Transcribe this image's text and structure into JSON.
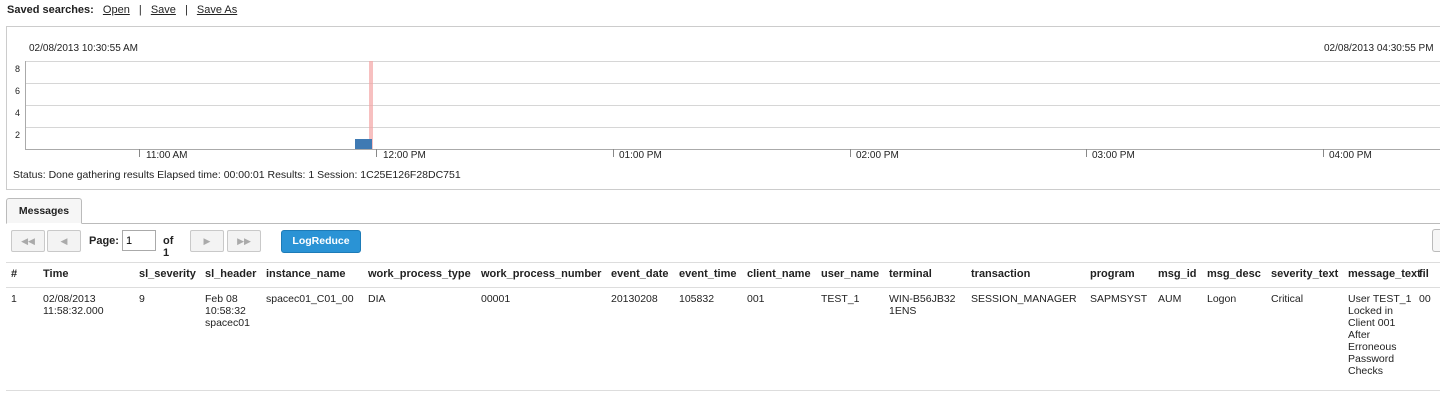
{
  "saved": {
    "label": "Saved searches:",
    "open": "Open",
    "save": "Save",
    "save_as": "Save As",
    "sep": "|"
  },
  "timeline": {
    "start_date": "02/08/2013 10:30:55 AM",
    "end_date": "02/08/2013 04:30:55 PM",
    "y_ticks": [
      "8",
      "6",
      "4",
      "2"
    ],
    "x_ticks": [
      "11:00 AM",
      "12:00 PM",
      "01:00 PM",
      "02:00 PM",
      "03:00 PM",
      "04:00 PM"
    ],
    "status": "Status: Done gathering results  Elapsed time: 00:00:01  Results: 1  Session: 1C25E126F28DC751",
    "colors": {
      "bar": "#3f7ab3",
      "marker": "#f3a5a5"
    }
  },
  "chart_data": {
    "type": "bar",
    "x_range": [
      "02/08/2013 10:30:55 AM",
      "02/08/2013 04:30:55 PM"
    ],
    "ylim": [
      0,
      9
    ],
    "points": [
      {
        "time": "02/08/2013 11:58:32 AM",
        "value": 1
      }
    ]
  },
  "tabs": [
    {
      "label": "Messages"
    }
  ],
  "pager": {
    "page_label": "Page:",
    "page_value": "1",
    "of_label": "of 1",
    "logreduce": "LogReduce"
  },
  "table": {
    "columns": [
      "#",
      "Time",
      "sl_severity",
      "sl_header",
      "instance_name",
      "work_process_type",
      "work_process_number",
      "event_date",
      "event_time",
      "client_name",
      "user_name",
      "terminal",
      "transaction",
      "program",
      "msg_id",
      "msg_desc",
      "severity_text",
      "message_text",
      "fil"
    ],
    "rows": [
      [
        "1",
        "02/08/2013 11:58:32.000",
        "9",
        "Feb 08 10:58:32 spacec01",
        "spacec01_C01_00",
        "DIA",
        "00001",
        "20130208",
        "105832",
        "001",
        "TEST_1",
        "WIN-B56JB321ENS",
        "SESSION_MANAGER",
        "SAPMSYST",
        "AUM",
        "Logon",
        "Critical",
        "User TEST_1 Locked in Client 001 After Erroneous Password Checks",
        "00"
      ]
    ]
  }
}
